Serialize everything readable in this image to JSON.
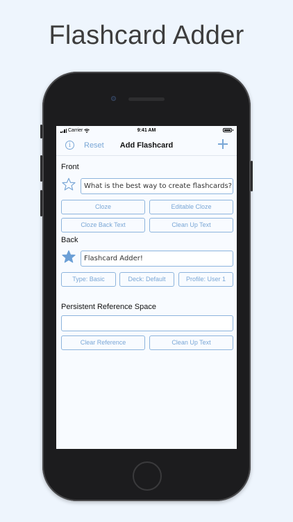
{
  "marketing": {
    "title": "Flashcard Adder"
  },
  "status_bar": {
    "carrier": "Carrier",
    "time": "9:41 AM"
  },
  "navbar": {
    "reset_label": "Reset",
    "title": "Add Flashcard"
  },
  "front": {
    "label": "Front",
    "value": "What is the best way to create flashcards?",
    "starred": false,
    "buttons": [
      "Cloze",
      "Editable Cloze",
      "Cloze Back Text",
      "Clean Up Text"
    ]
  },
  "back": {
    "label": "Back",
    "value": "Flashcard Adder!",
    "starred": true,
    "buttons": [
      "Type: Basic",
      "Deck: Default",
      "Profile: User 1"
    ]
  },
  "reference": {
    "label": "Persistent Reference Space",
    "value": "",
    "buttons": [
      "Clear Reference",
      "Clean Up Text"
    ]
  },
  "colors": {
    "accent": "#7aa7d6",
    "border": "#8db4dd",
    "background": "#eef5fd"
  },
  "icons": {
    "info": "info-icon",
    "add": "plus-icon",
    "star_empty": "star-outline-icon",
    "star_filled": "star-filled-icon"
  }
}
